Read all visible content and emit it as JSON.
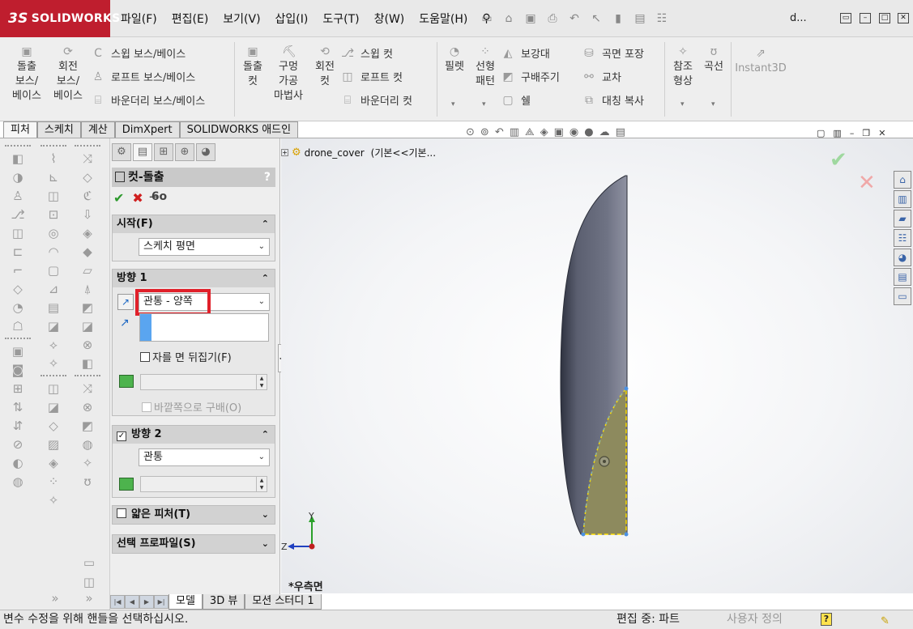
{
  "app": {
    "brand": "SOLIDWORKS",
    "brand_prefix": "3S",
    "doc_name": "d...",
    "menus": [
      "파일(F)",
      "편집(E)",
      "보기(V)",
      "삽입(I)",
      "도구(T)",
      "창(W)",
      "도움말(H)"
    ]
  },
  "ribbon": {
    "extrude_boss": [
      "돌출",
      "보스/",
      "베이스"
    ],
    "revolve_boss": [
      "회전",
      "보스/",
      "베이스"
    ],
    "swept_boss": "스윕 보스/베이스",
    "loft_boss": "로프트 보스/베이스",
    "boundary_boss": "바운더리 보스/베이스",
    "extrude_cut": [
      "돌출",
      "컷"
    ],
    "hole_wizard": [
      "구멍",
      "가공",
      "마법사"
    ],
    "revolve_cut": [
      "회전",
      "컷"
    ],
    "swept_cut": "스윕 컷",
    "loft_cut": "로프트 컷",
    "boundary_cut": "바운더리 컷",
    "fillet": "필렛",
    "linear_pattern": [
      "선형",
      "패턴"
    ],
    "rib": "보강대",
    "draft": "구배주기",
    "shell": "쉘",
    "wrap": "곡면 포장",
    "intersect": "교차",
    "mirror": "대칭 복사",
    "ref_geometry": [
      "참조",
      "형상"
    ],
    "curves": "곡선",
    "instant3d": "Instant3D"
  },
  "command_tabs": [
    "피처",
    "스케치",
    "계산",
    "DimXpert",
    "SOLIDWORKS 애드인"
  ],
  "property_manager": {
    "title": "컷-돌출",
    "help": "?",
    "from": {
      "header": "시작(F)",
      "value": "스케치 평면"
    },
    "direction1": {
      "header": "방향 1",
      "end_condition": "관통 - 양쪽",
      "flip_side": "자를 면 뒤집기(F)",
      "draft_outward": "바깥쪽으로 구배(O)"
    },
    "direction2": {
      "header": "방향 2",
      "checked": true,
      "end_condition": "관통"
    },
    "thin_feature": {
      "header": "얇은 피처(T)"
    },
    "selected_contours": {
      "header": "선택 프로파일(S)"
    }
  },
  "bottom_tabs": [
    "모델",
    "3D 뷰",
    "모션 스터디 1"
  ],
  "graphics": {
    "tree_root": "drone_cover",
    "tree_config": "(기본<<기본...",
    "view_label": "*우측면",
    "triad": {
      "y": "Y",
      "z": "Z"
    }
  },
  "status": {
    "message": "변수 수정을 위해 핸들을 선택하십시오.",
    "mode": "편집 중: 파트",
    "units": "사용자 정의",
    "help": "?"
  },
  "colors": {
    "brand_red": "#bf1e2e",
    "highlight_box": "#e0202a",
    "profile_fill": "#8d8a5e",
    "profile_edge": "#ffe000",
    "body": "#5a5e6e"
  }
}
